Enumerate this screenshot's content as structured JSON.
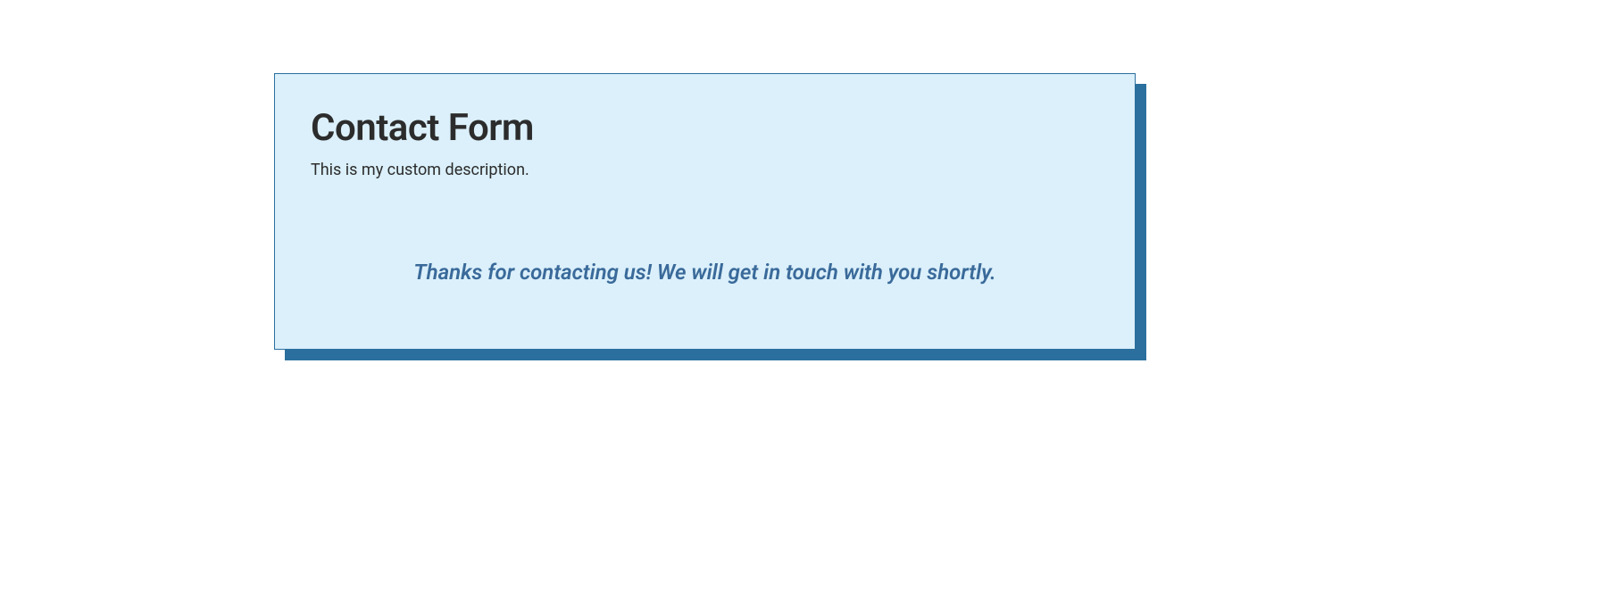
{
  "form": {
    "title": "Contact Form",
    "description": "This is my custom description.",
    "confirmation": "Thanks for contacting us! We will get in touch with you shortly."
  }
}
